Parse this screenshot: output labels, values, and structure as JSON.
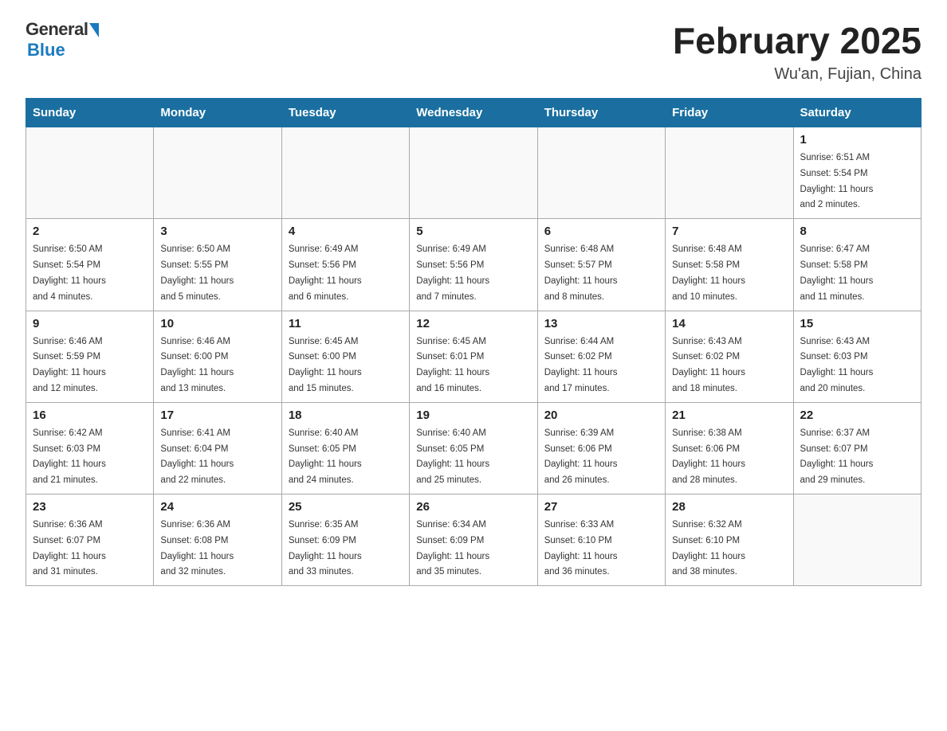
{
  "header": {
    "logo_general": "General",
    "logo_blue": "Blue",
    "title": "February 2025",
    "subtitle": "Wu'an, Fujian, China"
  },
  "weekdays": [
    "Sunday",
    "Monday",
    "Tuesday",
    "Wednesday",
    "Thursday",
    "Friday",
    "Saturday"
  ],
  "weeks": [
    [
      {
        "day": "",
        "info": ""
      },
      {
        "day": "",
        "info": ""
      },
      {
        "day": "",
        "info": ""
      },
      {
        "day": "",
        "info": ""
      },
      {
        "day": "",
        "info": ""
      },
      {
        "day": "",
        "info": ""
      },
      {
        "day": "1",
        "info": "Sunrise: 6:51 AM\nSunset: 5:54 PM\nDaylight: 11 hours\nand 2 minutes."
      }
    ],
    [
      {
        "day": "2",
        "info": "Sunrise: 6:50 AM\nSunset: 5:54 PM\nDaylight: 11 hours\nand 4 minutes."
      },
      {
        "day": "3",
        "info": "Sunrise: 6:50 AM\nSunset: 5:55 PM\nDaylight: 11 hours\nand 5 minutes."
      },
      {
        "day": "4",
        "info": "Sunrise: 6:49 AM\nSunset: 5:56 PM\nDaylight: 11 hours\nand 6 minutes."
      },
      {
        "day": "5",
        "info": "Sunrise: 6:49 AM\nSunset: 5:56 PM\nDaylight: 11 hours\nand 7 minutes."
      },
      {
        "day": "6",
        "info": "Sunrise: 6:48 AM\nSunset: 5:57 PM\nDaylight: 11 hours\nand 8 minutes."
      },
      {
        "day": "7",
        "info": "Sunrise: 6:48 AM\nSunset: 5:58 PM\nDaylight: 11 hours\nand 10 minutes."
      },
      {
        "day": "8",
        "info": "Sunrise: 6:47 AM\nSunset: 5:58 PM\nDaylight: 11 hours\nand 11 minutes."
      }
    ],
    [
      {
        "day": "9",
        "info": "Sunrise: 6:46 AM\nSunset: 5:59 PM\nDaylight: 11 hours\nand 12 minutes."
      },
      {
        "day": "10",
        "info": "Sunrise: 6:46 AM\nSunset: 6:00 PM\nDaylight: 11 hours\nand 13 minutes."
      },
      {
        "day": "11",
        "info": "Sunrise: 6:45 AM\nSunset: 6:00 PM\nDaylight: 11 hours\nand 15 minutes."
      },
      {
        "day": "12",
        "info": "Sunrise: 6:45 AM\nSunset: 6:01 PM\nDaylight: 11 hours\nand 16 minutes."
      },
      {
        "day": "13",
        "info": "Sunrise: 6:44 AM\nSunset: 6:02 PM\nDaylight: 11 hours\nand 17 minutes."
      },
      {
        "day": "14",
        "info": "Sunrise: 6:43 AM\nSunset: 6:02 PM\nDaylight: 11 hours\nand 18 minutes."
      },
      {
        "day": "15",
        "info": "Sunrise: 6:43 AM\nSunset: 6:03 PM\nDaylight: 11 hours\nand 20 minutes."
      }
    ],
    [
      {
        "day": "16",
        "info": "Sunrise: 6:42 AM\nSunset: 6:03 PM\nDaylight: 11 hours\nand 21 minutes."
      },
      {
        "day": "17",
        "info": "Sunrise: 6:41 AM\nSunset: 6:04 PM\nDaylight: 11 hours\nand 22 minutes."
      },
      {
        "day": "18",
        "info": "Sunrise: 6:40 AM\nSunset: 6:05 PM\nDaylight: 11 hours\nand 24 minutes."
      },
      {
        "day": "19",
        "info": "Sunrise: 6:40 AM\nSunset: 6:05 PM\nDaylight: 11 hours\nand 25 minutes."
      },
      {
        "day": "20",
        "info": "Sunrise: 6:39 AM\nSunset: 6:06 PM\nDaylight: 11 hours\nand 26 minutes."
      },
      {
        "day": "21",
        "info": "Sunrise: 6:38 AM\nSunset: 6:06 PM\nDaylight: 11 hours\nand 28 minutes."
      },
      {
        "day": "22",
        "info": "Sunrise: 6:37 AM\nSunset: 6:07 PM\nDaylight: 11 hours\nand 29 minutes."
      }
    ],
    [
      {
        "day": "23",
        "info": "Sunrise: 6:36 AM\nSunset: 6:07 PM\nDaylight: 11 hours\nand 31 minutes."
      },
      {
        "day": "24",
        "info": "Sunrise: 6:36 AM\nSunset: 6:08 PM\nDaylight: 11 hours\nand 32 minutes."
      },
      {
        "day": "25",
        "info": "Sunrise: 6:35 AM\nSunset: 6:09 PM\nDaylight: 11 hours\nand 33 minutes."
      },
      {
        "day": "26",
        "info": "Sunrise: 6:34 AM\nSunset: 6:09 PM\nDaylight: 11 hours\nand 35 minutes."
      },
      {
        "day": "27",
        "info": "Sunrise: 6:33 AM\nSunset: 6:10 PM\nDaylight: 11 hours\nand 36 minutes."
      },
      {
        "day": "28",
        "info": "Sunrise: 6:32 AM\nSunset: 6:10 PM\nDaylight: 11 hours\nand 38 minutes."
      },
      {
        "day": "",
        "info": ""
      }
    ]
  ]
}
